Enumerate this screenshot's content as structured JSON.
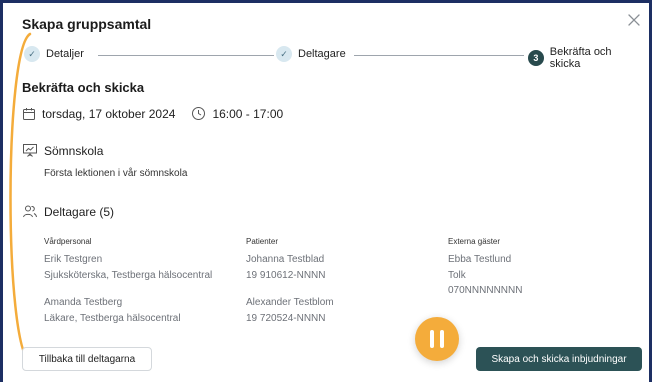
{
  "dialog": {
    "title": "Skapa gruppsamtal"
  },
  "stepper": {
    "steps": [
      {
        "label": "Detaljer",
        "state": "done",
        "marker": "✓"
      },
      {
        "label": "Deltagare",
        "state": "done",
        "marker": "✓"
      },
      {
        "label": "Bekräfta och skicka",
        "state": "active",
        "marker": "3"
      }
    ]
  },
  "confirm": {
    "heading": "Bekräfta och skicka",
    "date": "torsdag, 17 oktober 2024",
    "time": "16:00 - 17:00",
    "activity_name": "Sömnskola",
    "activity_desc": "Första lektionen i vår sömnskola",
    "participants_label": "Deltagare (5)"
  },
  "columns": [
    {
      "header": "Vårdpersonal",
      "entries": [
        [
          "Erik Testgren",
          "Sjuksköterska, Testberga hälsocentral"
        ],
        [
          "Amanda Testberg",
          "Läkare, Testberga hälsocentral"
        ]
      ]
    },
    {
      "header": "Patienter",
      "entries": [
        [
          "Johanna Testblad",
          "19 910612-NNNN"
        ],
        [
          "Alexander Testblom",
          "19 720524-NNNN"
        ]
      ]
    },
    {
      "header": "Externa gäster",
      "entries": [
        [
          "Ebba Testlund",
          "Tolk",
          "070NNNNNNNN"
        ]
      ]
    }
  ],
  "buttons": {
    "back": "Tillbaka till deltagarna",
    "send": "Skapa och skicka inbjudningar"
  },
  "icons": {
    "close": "close-icon",
    "calendar": "calendar-icon",
    "clock": "clock-icon",
    "presentation": "presentation-icon",
    "people": "people-icon",
    "pause": "pause-icon"
  },
  "colors": {
    "frame": "#1d2f63",
    "primary_button": "#2c5256",
    "active_step": "#284a4d",
    "done_step": "#d8e8f0",
    "pause_overlay": "#f4ac3b"
  }
}
